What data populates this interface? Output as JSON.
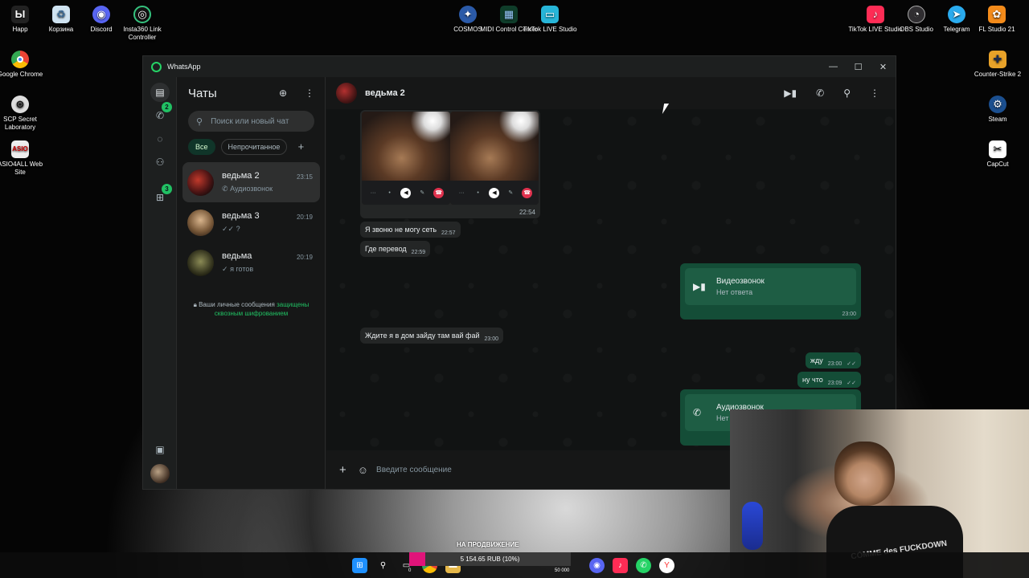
{
  "desktop": {
    "icons_left": [
      {
        "label": "Happ",
        "icon": "happ-icon"
      },
      {
        "label": "Корзина",
        "icon": "recycle-bin-icon"
      },
      {
        "label": "Discord",
        "icon": "discord-icon"
      },
      {
        "label": "Insta360 Link Controller",
        "icon": "insta360-icon"
      },
      {
        "label": "Google Chrome",
        "icon": "chrome-icon"
      },
      {
        "label": "SCP Secret Laboratory",
        "icon": "scp-icon"
      },
      {
        "label": "ASIO4ALL Web Site",
        "icon": "asio-icon"
      }
    ],
    "icons_center": [
      {
        "label": "COSMOS",
        "icon": "cosmos-icon"
      },
      {
        "label": "MIDI Control Center",
        "icon": "midi-icon"
      },
      {
        "label": "TikTok LIVE Studio",
        "icon": "tiktok-live-icon"
      }
    ],
    "icons_right": [
      {
        "label": "TikTok LIVE Studio",
        "icon": "tiktok-live-icon"
      },
      {
        "label": "OBS Studio",
        "icon": "obs-icon"
      },
      {
        "label": "Telegram",
        "icon": "telegram-icon"
      },
      {
        "label": "FL Studio 21",
        "icon": "fl-studio-icon"
      },
      {
        "label": "Counter-Strike 2",
        "icon": "cs2-icon"
      },
      {
        "label": "Steam",
        "icon": "steam-icon"
      },
      {
        "label": "CapCut",
        "icon": "capcut-icon"
      }
    ]
  },
  "window": {
    "title": "WhatsApp",
    "controls": {
      "minimize": "—",
      "maximize": "☐",
      "close": "✕"
    }
  },
  "rail": {
    "calls_badge": "2",
    "status_badge": "3"
  },
  "chatlist": {
    "title": "Чаты",
    "search_placeholder": "Поиск или новый чат",
    "filters": [
      "Все",
      "Непрочитанное"
    ],
    "chats": [
      {
        "name": "ведьма 2",
        "time": "23:15",
        "preview": "Аудиозвонок",
        "preview_icon": "phone-icon"
      },
      {
        "name": "ведьма 3",
        "time": "20:19",
        "preview": "?",
        "preview_icon": "double-check-icon"
      },
      {
        "name": "ведьма",
        "time": "20:19",
        "preview": "я готов",
        "preview_icon": "check-icon"
      }
    ],
    "encryption_note": "Ваши личные сообщения",
    "encryption_link": "защищены сквозным шифрованием"
  },
  "conversation": {
    "contact_name": "ведьма 2",
    "media_time": "22:54",
    "messages_in": [
      {
        "text": "Я звоню не могу сеть",
        "time": "22:57"
      },
      {
        "text": "Где перевод",
        "time": "22:59"
      },
      {
        "text": "Ждите я в дом зайду там вай фай",
        "time": "23:00"
      }
    ],
    "video_call": {
      "title": "Видеозвонок",
      "status": "Нет ответа",
      "time": "23:00"
    },
    "messages_out": [
      {
        "text": "жду",
        "time": "23:00"
      },
      {
        "text": "ну что",
        "time": "23:09"
      }
    ],
    "audio_call": {
      "title": "Аудиозвонок",
      "status": "Нет"
    },
    "composer_placeholder": "Введите сообщение"
  },
  "overlay": {
    "promo_text": "НА ПРОДВИЖЕНИЕ",
    "donation_text": "5 154.65 RUB (10%)",
    "donation_progress": 0.1,
    "shirt_text": "COMME des FUCKDOWN"
  },
  "taskbar": {
    "badge_zero": "0",
    "badge_count": "50 000"
  }
}
